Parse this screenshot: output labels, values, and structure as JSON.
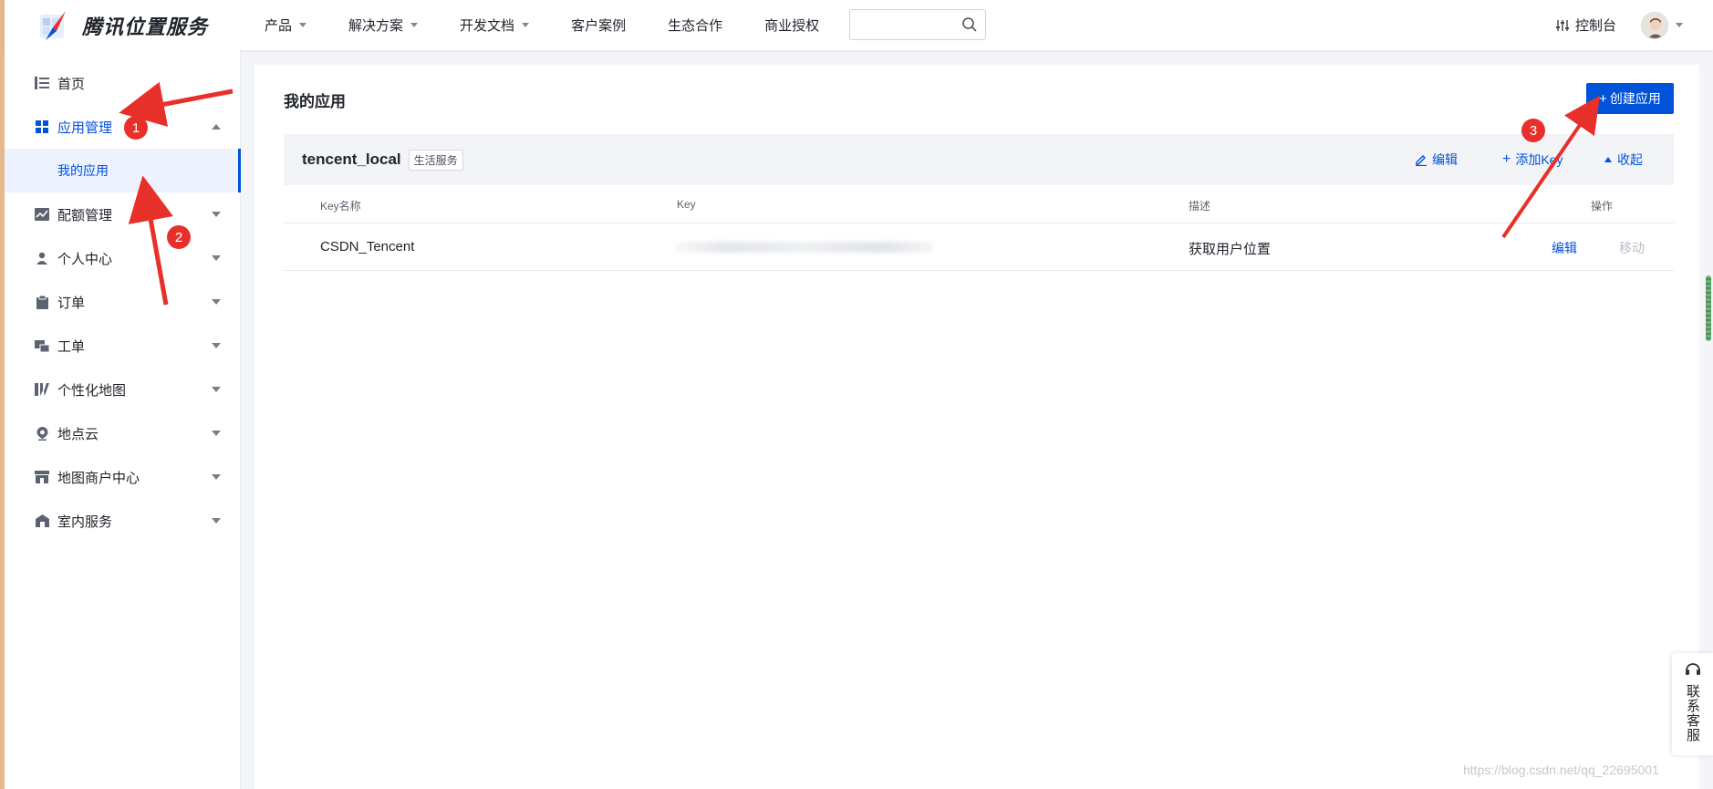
{
  "header": {
    "brand": "腾讯位置服务",
    "nav": [
      {
        "label": "产品",
        "dropdown": true
      },
      {
        "label": "解决方案",
        "dropdown": true
      },
      {
        "label": "开发文档",
        "dropdown": true
      },
      {
        "label": "客户案例",
        "dropdown": false
      },
      {
        "label": "生态合作",
        "dropdown": false
      },
      {
        "label": "商业授权",
        "dropdown": false
      }
    ],
    "search_placeholder": "",
    "console": "控制台"
  },
  "sidebar": {
    "items": [
      {
        "label": "首页"
      },
      {
        "label": "应用管理"
      },
      {
        "label": "配额管理"
      },
      {
        "label": "个人中心"
      },
      {
        "label": "订单"
      },
      {
        "label": "工单"
      },
      {
        "label": "个性化地图"
      },
      {
        "label": "地点云"
      },
      {
        "label": "地图商户中心"
      },
      {
        "label": "室内服务"
      }
    ],
    "sub_active": "我的应用"
  },
  "main": {
    "title": "我的应用",
    "create_button": "创建应用",
    "app": {
      "name": "tencent_local",
      "tag": "生活服务",
      "actions": {
        "edit": "编辑",
        "add_key": "添加Key",
        "collapse": "收起"
      },
      "columns": [
        "Key名称",
        "Key",
        "描述",
        "操作"
      ],
      "rows": [
        {
          "name": "CSDN_Tencent",
          "desc": "获取用户位置",
          "op_edit": "编辑",
          "op_move": "移动"
        }
      ]
    }
  },
  "support": {
    "label": "联系客服"
  },
  "watermark": "https://blog.csdn.net/qq_22695001",
  "annotations": {
    "badges": [
      "1",
      "2",
      "3"
    ]
  },
  "colors": {
    "accent": "#0052d9",
    "annotation": "#e8302a",
    "active_bg": "#ecf2fe"
  }
}
